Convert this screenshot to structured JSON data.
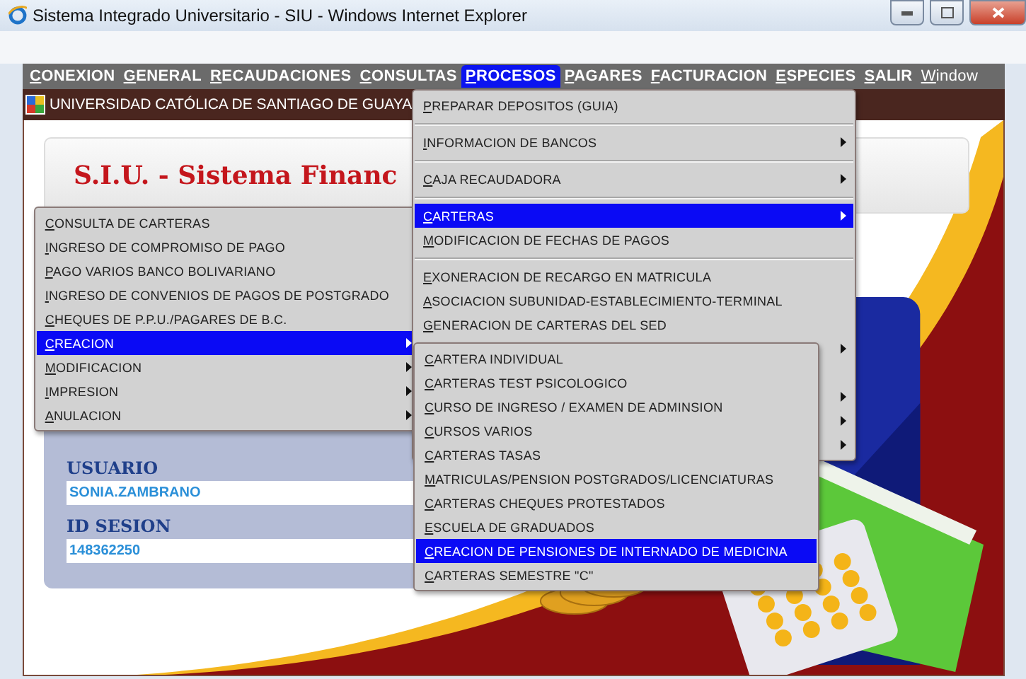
{
  "window": {
    "title": "Sistema Integrado Universitario - SIU - Windows Internet Explorer"
  },
  "menu_bar": [
    {
      "label": "CONEXION",
      "selected": false,
      "kind": "app"
    },
    {
      "label": "GENERAL",
      "selected": false,
      "kind": "app"
    },
    {
      "label": "RECAUDACIONES",
      "selected": false,
      "kind": "app"
    },
    {
      "label": "CONSULTAS",
      "selected": false,
      "kind": "app"
    },
    {
      "label": "PROCESOS",
      "selected": true,
      "kind": "app"
    },
    {
      "label": "PAGARES",
      "selected": false,
      "kind": "app"
    },
    {
      "label": "FACTURACION",
      "selected": false,
      "kind": "app"
    },
    {
      "label": "ESPECIES",
      "selected": false,
      "kind": "app"
    },
    {
      "label": "SALIR",
      "selected": false,
      "kind": "app"
    },
    {
      "label": "Window",
      "selected": false,
      "kind": "window"
    }
  ],
  "inner_window": {
    "title": "UNIVERSIDAD CATÓLICA DE SANTIAGO DE GUAYA"
  },
  "header": {
    "title": "S.I.U. - Sistema Financ"
  },
  "user_panel": {
    "fields": [
      {
        "label": "USUARIO",
        "value": "SONIA.ZAMBRANO"
      },
      {
        "label": "ID SESION",
        "value": "148362250"
      }
    ]
  },
  "procesos_menu": {
    "items": [
      {
        "kind": "item",
        "label": "PREPARAR DEPOSITOS (GUIA)",
        "selected": false,
        "submenu": false,
        "separator_after": true
      },
      {
        "kind": "item",
        "label": "INFORMACION DE BANCOS",
        "selected": false,
        "submenu": true,
        "separator_after": true
      },
      {
        "kind": "item",
        "label": "CAJA RECAUDADORA",
        "selected": false,
        "submenu": true,
        "separator_after": true
      },
      {
        "kind": "item",
        "label": "CARTERAS",
        "selected": true,
        "submenu": true,
        "separator_after": false
      },
      {
        "kind": "item",
        "label": "MODIFICACION DE FECHAS DE PAGOS",
        "selected": false,
        "submenu": false,
        "separator_after": true
      },
      {
        "kind": "item",
        "label": "EXONERACION DE RECARGO EN MATRICULA",
        "selected": false,
        "submenu": false,
        "separator_after": false
      },
      {
        "kind": "item",
        "label": "ASOCIACION SUBUNIDAD-ESTABLECIMIENTO-TERMINAL",
        "selected": false,
        "submenu": false,
        "separator_after": false
      },
      {
        "kind": "item",
        "label": "GENERACION DE CARTERAS DEL SED",
        "selected": false,
        "submenu": false,
        "separator_after": false
      },
      {
        "kind": "covered",
        "selected": false,
        "submenu": true,
        "separator_after": false
      },
      {
        "kind": "covered",
        "selected": false,
        "submenu": false,
        "separator_after": false
      },
      {
        "kind": "covered",
        "selected": false,
        "submenu": true,
        "separator_after": false
      },
      {
        "kind": "covered",
        "selected": false,
        "submenu": true,
        "separator_after": false
      },
      {
        "kind": "covered",
        "selected": false,
        "submenu": true,
        "separator_after": false
      }
    ]
  },
  "carteras_submenu": {
    "items": [
      {
        "label": "CONSULTA DE CARTERAS",
        "selected": false,
        "submenu": false
      },
      {
        "label": "INGRESO DE COMPROMISO DE PAGO",
        "selected": false,
        "submenu": false
      },
      {
        "label": "PAGO VARIOS BANCO BOLIVARIANO",
        "selected": false,
        "submenu": false
      },
      {
        "label": "INGRESO DE CONVENIOS DE PAGOS DE POSTGRADO",
        "selected": false,
        "submenu": false
      },
      {
        "label": "CHEQUES DE P.P.U./PAGARES DE B.C.",
        "selected": false,
        "submenu": false
      },
      {
        "label": "CREACION",
        "selected": true,
        "submenu": true
      },
      {
        "label": "MODIFICACION",
        "selected": false,
        "submenu": true
      },
      {
        "label": "IMPRESION",
        "selected": false,
        "submenu": true
      },
      {
        "label": "ANULACION",
        "selected": false,
        "submenu": true
      }
    ]
  },
  "creacion_submenu": {
    "items": [
      {
        "label": "CARTERA INDIVIDUAL",
        "selected": false
      },
      {
        "label": "CARTERAS TEST PSICOLOGICO",
        "selected": false
      },
      {
        "label": "CURSO DE INGRESO / EXAMEN DE ADMINSION",
        "selected": false
      },
      {
        "label": "CURSOS VARIOS",
        "selected": false
      },
      {
        "label": "CARTERAS TASAS",
        "selected": false
      },
      {
        "label": "MATRICULAS/PENSION POSTGRADOS/LICENCIATURAS",
        "selected": false
      },
      {
        "label": "CARTERAS CHEQUES PROTESTADOS",
        "selected": false
      },
      {
        "label": "ESCUELA DE GRADUADOS",
        "selected": false
      },
      {
        "label": "CREACION DE PENSIONES DE INTERNADO DE MEDICINA",
        "selected": true
      },
      {
        "label": "CARTERAS SEMESTRE \"C\"",
        "selected": false
      }
    ]
  }
}
